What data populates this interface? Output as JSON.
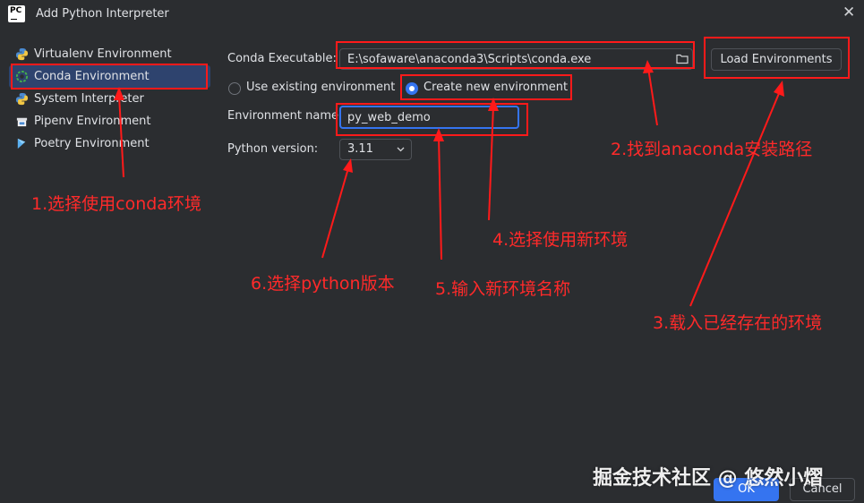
{
  "window": {
    "title": "Add Python Interpreter",
    "logo_text": "PC",
    "close_glyph": "✕"
  },
  "sidebar": {
    "items": [
      {
        "label": "Virtualenv Environment",
        "icon": "python-icon",
        "selected": false
      },
      {
        "label": "Conda Environment",
        "icon": "conda-icon",
        "selected": true
      },
      {
        "label": "System Interpreter",
        "icon": "python-icon",
        "selected": false
      },
      {
        "label": "Pipenv Environment",
        "icon": "pipenv-icon",
        "selected": false
      },
      {
        "label": "Poetry Environment",
        "icon": "poetry-icon",
        "selected": false
      }
    ]
  },
  "form": {
    "conda_executable_label": "Conda Executable:",
    "conda_executable_value": "E:\\sofaware\\anaconda3\\Scripts\\conda.exe",
    "load_environments_label": "Load Environments",
    "use_existing_label": "Use existing environment",
    "create_new_label": "Create new environment",
    "selected_mode": "create_new",
    "env_name_label": "Environment name:",
    "env_name_value": "py_web_demo",
    "python_version_label": "Python version:",
    "python_version_value": "3.11"
  },
  "footer": {
    "ok_label": "OK",
    "cancel_label": "Cancel"
  },
  "annotations": {
    "a1": "1.选择使用conda环境",
    "a2": "2.找到anaconda安装路径",
    "a3": "3.载入已经存在的环境",
    "a4": "4.选择使用新环境",
    "a5": "5.输入新环境名称",
    "a6": "6.选择python版本",
    "color": "#ff1a1a"
  },
  "watermark": "掘金技术社区 @ 悠然小熠",
  "colors": {
    "background": "#2b2d30",
    "accent": "#3574f0",
    "selection": "#2e436e",
    "annotation": "#ff1a1a"
  }
}
